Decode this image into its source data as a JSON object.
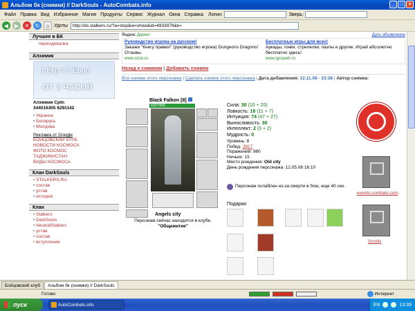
{
  "window": {
    "title": "Альбом бк (снимки) // DarkSouls - AutoCombats.info"
  },
  "menu": {
    "items": [
      "Файл",
      "Правка",
      "Вид",
      "Избранное",
      "Магия",
      "Продукты",
      "Сервис",
      "Журнал",
      "Окна",
      "Справка"
    ],
    "login_label": "Логин:",
    "beast_label": "Зверь:"
  },
  "toolbar": {
    "tools_label": "Удоты",
    "address": "http://ds.stalkers.ru/?a=stop&w=show&id=4933979&k="
  },
  "sidebar": {
    "best_header": "Лучшее в БК",
    "best_item": "переодевалка",
    "alchemist_header": "Алхимик",
    "banner_line1": "1 Екр = 1 Евро",
    "banner_line2": "ОТ 2 ЧАСОВ",
    "alch_names": "Алхимик  Cptn",
    "alch_icq": "344016305  6291142",
    "countries": [
      "Украина",
      "Беларусь",
      "Молдова"
    ],
    "google_title": "Реклама от Google",
    "google_links": [
      "БОЙЦОВСКИЙ КЛУБ",
      "НОВОСТИ КОСМОСА",
      "ФОТО КОСМОС",
      "ТАДЖИКИСТАН",
      "ВИДЫ КОСМОСА"
    ],
    "clan_header": "Клан DarkSouls",
    "clan_items": [
      "STALKERS.RU",
      "состав",
      "устав",
      "история"
    ],
    "clan2_header": "Клан",
    "clan2_items": [
      "Stalkers",
      "DarkSouls",
      "NeutralStalkers",
      "устав",
      "состав",
      "вступление"
    ]
  },
  "ads": {
    "yandex": "Яндекс",
    "direct": "Директ",
    "post_ad": "Дать объявление",
    "ad1_title": "Руководство игрока на русском!",
    "ad1_text": "Закажи \"Книгу правил\" (руководство игрока) Dungeons Dragons! Отзывы.",
    "ad1_url": "www.ozon.ru",
    "ad2_title": "Бесплатные игры для всех!",
    "ad2_text": "Аркады, гонки, стрелялки, пазлы и другие. Играй абсолютно бесплатно здесь!",
    "ad2_url": "www.igropark.ru"
  },
  "nav": {
    "back_link": "Назад к снимкам",
    "add_link": "Добавить снимок",
    "all_link": "Все снимки этого персонажа",
    "make_link": "Сделать снимок этого персонажа",
    "date_label": "Дата добавления:",
    "date_value": "12.11.08 - 23:38",
    "author_label": "Автор снимка:"
  },
  "character": {
    "name": "Black Falkon",
    "level": "[8]",
    "hp": "4327/996",
    "clan_name": "Angels city",
    "location_text": "Персонаж сейчас находится в клубе.",
    "location_place": "\"Общежитие\""
  },
  "stats": {
    "strength": "Сила: ",
    "strength_v": "30",
    "strength_s": " (10 + 20)",
    "agility": "Ловкость: ",
    "agility_v": "18",
    "agility_s": " (11 + 7)",
    "intuition": "Интуиция: ",
    "intuition_v": "74",
    "intuition_s": " (47 + 27)",
    "endurance": "Выносливость: ",
    "endurance_v": "30",
    "intellect": "Интеллект: ",
    "intellect_v": "2",
    "intellect_s": " (0 + 2)",
    "wisdom": "Мудрость: ",
    "wisdom_v": "0"
  },
  "info": {
    "level": "Уровень: 8",
    "wins_label": "Побед: ",
    "wins": "3917",
    "losses": "Поражений: 980",
    "draws": "Ничьих: 15",
    "birthplace_label": "Место рождения: ",
    "birthplace": "Old city",
    "birthday": "День рождения персонажа: 12.05.08 16:10"
  },
  "status": {
    "weakened": "Персонаж ослаблен из-за смерти в бою, еще 40 сек.",
    "gifts_label": "Подарки:"
  },
  "badges": {
    "events": "events.combats.com",
    "scrolls": "Scrolls"
  },
  "tabs": [
    "Бойцовский клуб",
    "Альбом бк (снимки) // DarkSouls"
  ],
  "statusbar": {
    "done": "Готово",
    "zone": "Интернет"
  },
  "taskbar": {
    "start": "пуск",
    "task": "AutoCombats.info",
    "lang": "EN",
    "clock": "13:39"
  }
}
